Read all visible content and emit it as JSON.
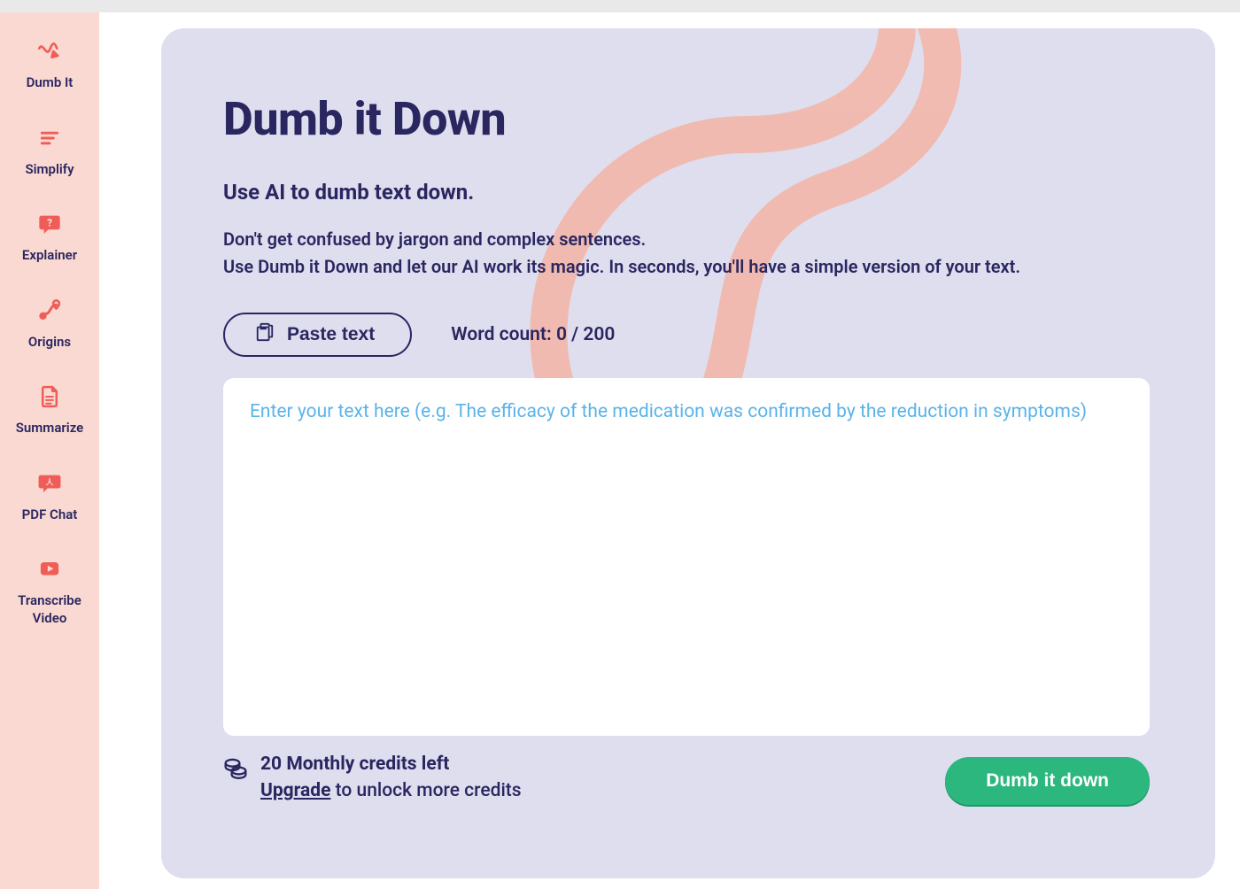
{
  "sidebar": {
    "items": [
      {
        "label": "Dumb It",
        "icon": "squiggle-arrow-icon"
      },
      {
        "label": "Simplify",
        "icon": "lines-icon"
      },
      {
        "label": "Explainer",
        "icon": "question-bubble-icon"
      },
      {
        "label": "Origins",
        "icon": "route-pin-icon"
      },
      {
        "label": "Summarize",
        "icon": "document-icon"
      },
      {
        "label": "PDF Chat",
        "icon": "pdf-chat-icon"
      },
      {
        "label": "Transcribe Video",
        "icon": "video-play-icon"
      }
    ]
  },
  "page": {
    "title": "Dumb it Down",
    "subtitle": "Use AI to dumb text down.",
    "desc_line1": "Don't get confused by jargon and complex sentences.",
    "desc_line2": "Use Dumb it Down and let our AI work its magic. In seconds, you'll have a simple version of your text."
  },
  "toolbar": {
    "paste_label": "Paste text",
    "wordcount_label": "Word count:",
    "wordcount_value": "0 / 200"
  },
  "input": {
    "value": "",
    "placeholder": "Enter your text here (e.g. The efficacy of the medication was confirmed by the reduction in symptoms)"
  },
  "credits": {
    "count_text": "20 Monthly credits left",
    "upgrade_label": "Upgrade",
    "upgrade_rest": " to unlock more credits"
  },
  "action": {
    "label": "Dumb it down"
  },
  "colors": {
    "accent": "#f05d58",
    "primary_text": "#2a2660",
    "panel_bg": "#dedeef",
    "sidebar_bg": "#f9d9d1",
    "cta_bg": "#2cb77f",
    "placeholder": "#5ab3e8"
  }
}
